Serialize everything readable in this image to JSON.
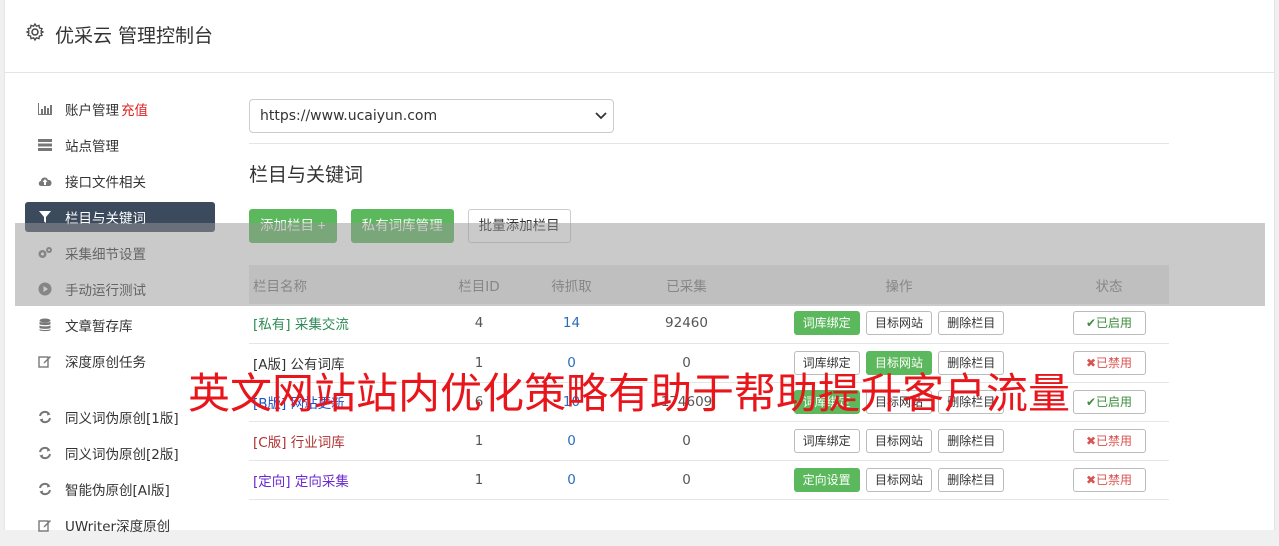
{
  "header": {
    "title": "优采云 管理控制台"
  },
  "sidebar": {
    "items": [
      {
        "label": "账户管理",
        "extra": "充值"
      },
      {
        "label": "站点管理"
      },
      {
        "label": "接口文件相关"
      },
      {
        "label": "栏目与关键词"
      },
      {
        "label": "采集细节设置"
      },
      {
        "label": "手动运行测试"
      },
      {
        "label": "文章暂存库"
      },
      {
        "label": "深度原创任务"
      },
      {
        "label": "同义词伪原创[1版]"
      },
      {
        "label": "同义词伪原创[2版]"
      },
      {
        "label": "智能伪原创[AI版]"
      },
      {
        "label": "UWriter深度原创"
      }
    ]
  },
  "main": {
    "site_select": "https://www.ucaiyun.com",
    "section_title": "栏目与关键词",
    "buttons": {
      "add_column": "添加栏目 +",
      "private_lexicon": "私有词库管理",
      "batch_add": "批量添加栏目"
    },
    "table": {
      "headers": [
        "栏目名称",
        "栏目ID",
        "待抓取",
        "已采集",
        "操作",
        "状态"
      ],
      "rows": [
        {
          "name": "[私有] 采集交流",
          "id": "4",
          "pending": "14",
          "collected": "92460",
          "op1": "词库绑定",
          "op2": "目标网站",
          "op3": "删除栏目",
          "status": "已启用"
        },
        {
          "name": "[A版] 公有词库",
          "id": "1",
          "pending": "0",
          "collected": "0",
          "op1": "词库绑定",
          "op2": "目标网站",
          "op3": "删除栏目",
          "status": "已禁用"
        },
        {
          "name": "[B版] 网站更新",
          "id": "6",
          "pending": "10",
          "collected": "174609",
          "op1": "词库绑定",
          "op2": "目标网站",
          "op3": "删除栏目",
          "status": "已启用"
        },
        {
          "name": "[C版] 行业词库",
          "id": "1",
          "pending": "0",
          "collected": "0",
          "op1": "词库绑定",
          "op2": "目标网站",
          "op3": "删除栏目",
          "status": "已禁用"
        },
        {
          "name": "[定向] 定向采集",
          "id": "1",
          "pending": "0",
          "collected": "0",
          "op1": "定向设置",
          "op2": "目标网站",
          "op3": "删除栏目",
          "status": "已禁用"
        }
      ]
    }
  },
  "watermark": "英文网站站内优化策略有助于帮助提升客户流量",
  "colors": {
    "green": "#5cb85c",
    "nav_active": "#3c4a5e",
    "watermark": "#e8151b"
  }
}
